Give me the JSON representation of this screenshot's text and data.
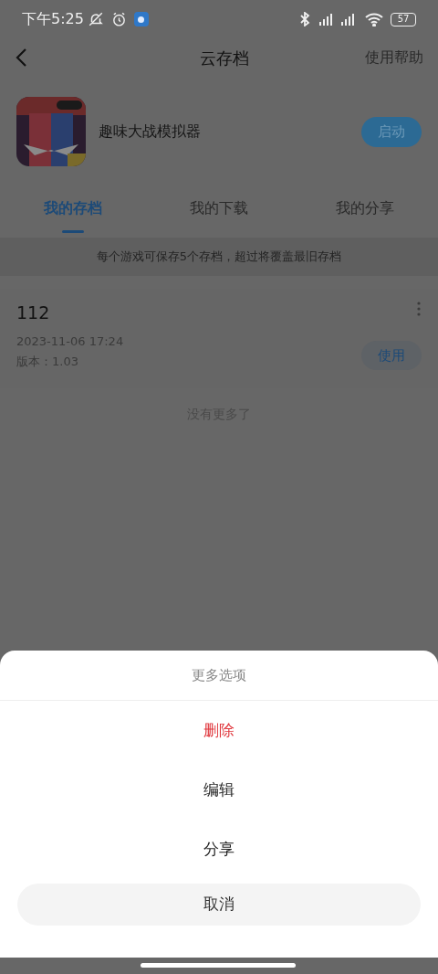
{
  "status_bar": {
    "time": "下午5:25",
    "battery": "57"
  },
  "header": {
    "title": "云存档",
    "help": "使用帮助"
  },
  "game": {
    "name": "趣味大战模拟器",
    "launch": "启动"
  },
  "tabs": [
    {
      "label": "我的存档",
      "selected": true
    },
    {
      "label": "我的下载",
      "selected": false
    },
    {
      "label": "我的分享",
      "selected": false
    }
  ],
  "notice": "每个游戏可保存5个存档，超过将覆盖最旧存档",
  "saves": [
    {
      "name": "112",
      "time": "2023-11-06 17:24",
      "version": "版本：1.03",
      "action": "使用"
    }
  ],
  "end_text": "没有更多了",
  "sheet": {
    "title": "更多选项",
    "options": [
      {
        "label": "删除",
        "kind": "danger"
      },
      {
        "label": "编辑",
        "kind": "normal"
      },
      {
        "label": "分享",
        "kind": "normal"
      }
    ],
    "cancel": "取消"
  }
}
